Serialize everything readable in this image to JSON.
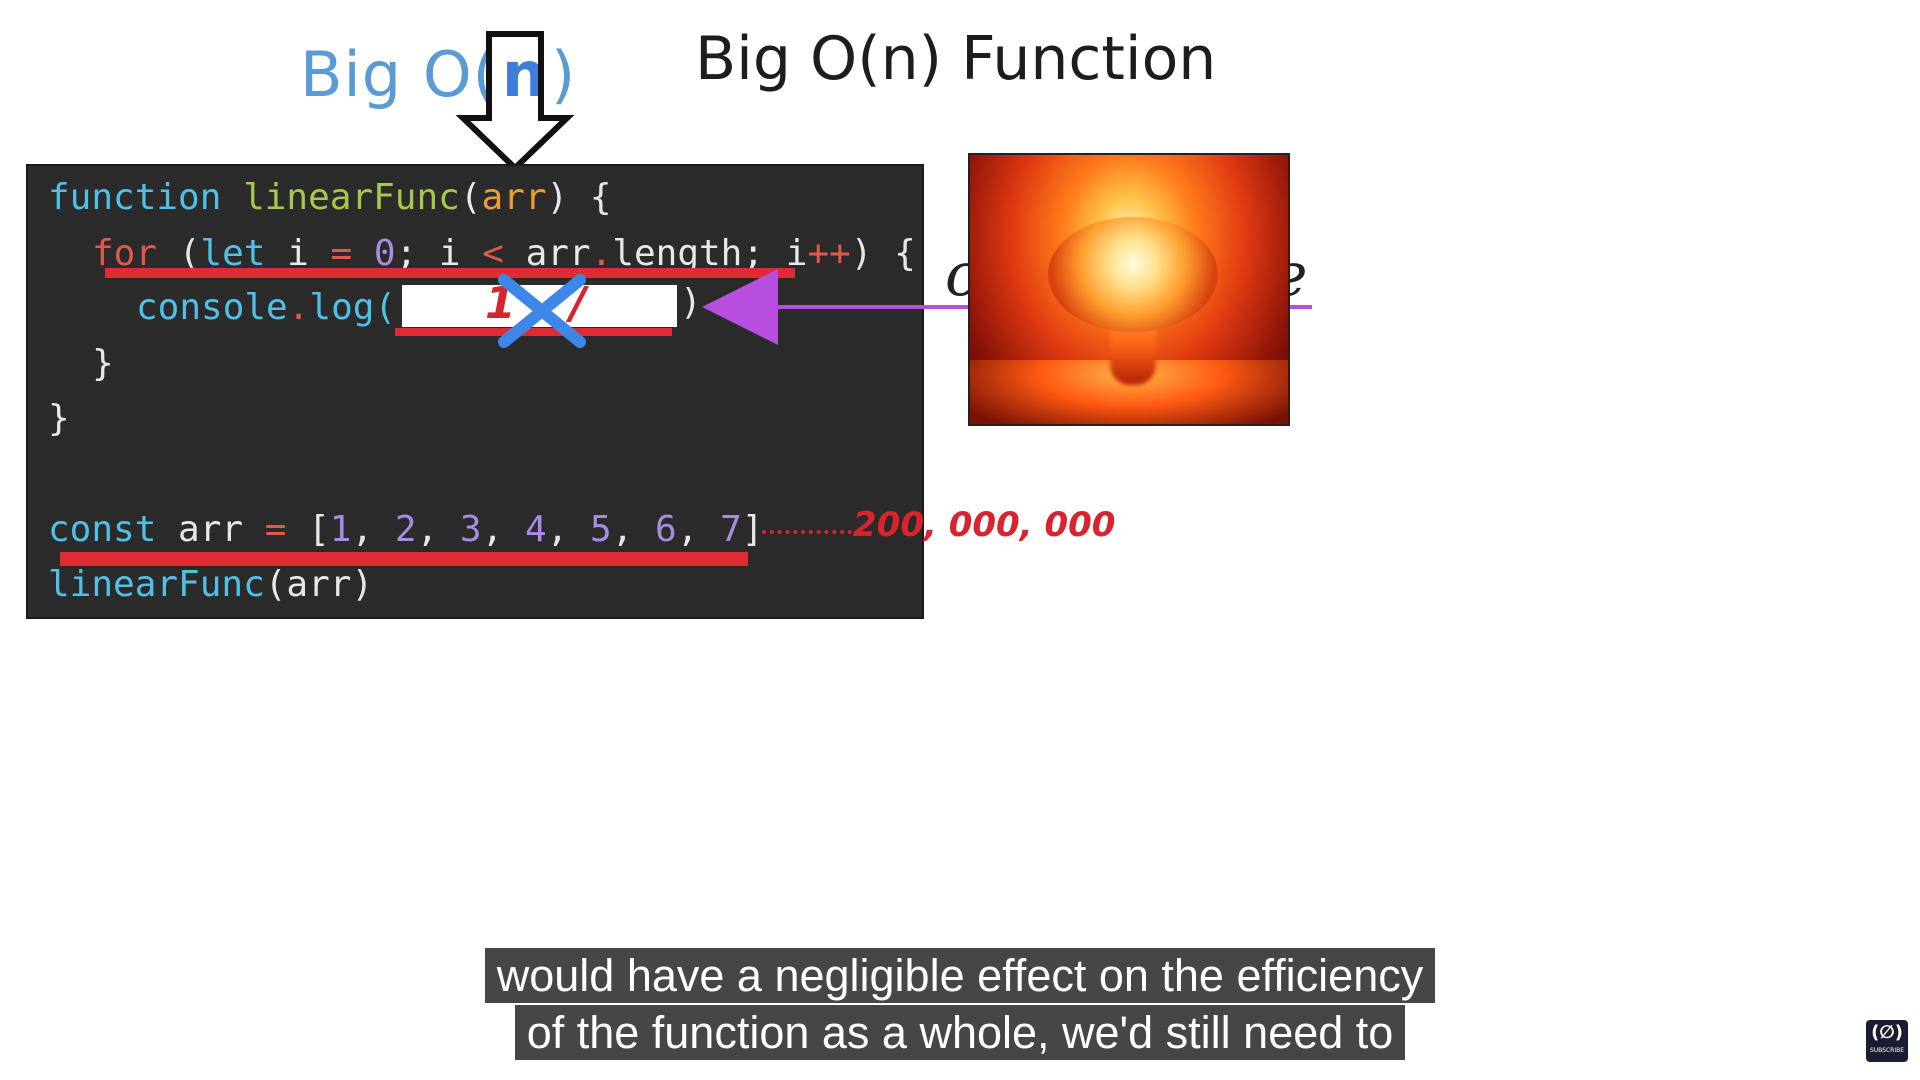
{
  "titles": {
    "bigo_prefix": "Big O(",
    "bigo_var": "n",
    "bigo_suffix": ")",
    "function_title": "Big O(n) Function"
  },
  "code": {
    "line1": {
      "kw": "function",
      "fn": "linearFunc",
      "open": "(",
      "param": "arr",
      "close": ") {"
    },
    "line2": {
      "kw": "for",
      "p1": " (",
      "kw2": "let",
      "p2": " i ",
      "eq": "=",
      "sp": " ",
      "zero": "0",
      "p3": "; i ",
      "lt": "<",
      "p4": " arr",
      "dot": ".",
      "p5": "length; i",
      "pp": "++",
      "p6": ") {"
    },
    "line3": {
      "obj": "console",
      "dot": ".",
      "method": "log("
    },
    "line4": "}",
    "line5": "}",
    "line6": {
      "kw": "const",
      "name": " arr ",
      "eq": "=",
      "open": " [",
      "n1": "1",
      "n2": "2",
      "n3": "3",
      "n4": "4",
      "n5": "5",
      "n6": "6",
      "n7": "7",
      "close": "]",
      "sep": ", "
    },
    "line7": {
      "fn": "linearFunc",
      "args": "(arr)"
    },
    "log_close": ")"
  },
  "annotations": {
    "red_one": "1",
    "red_slash": "/",
    "big_number": "200, 000, 000",
    "italic_left": "c",
    "italic_right": "e"
  },
  "captions": {
    "line1": "would have a negligible effect on the efficiency",
    "line2": "of the function as a whole, we'd still need to"
  },
  "logo": {
    "glyph": "(∅)",
    "label": "SUBSCRIBE"
  },
  "colors": {
    "code_background": "#2b2b2b",
    "red_annotation": "#d9232e",
    "purple_arrow": "#b84ee0",
    "blue_title": "#5b9bd5"
  },
  "icons": {
    "down_arrow": "down-arrow-icon",
    "left_arrow": "left-arrow-icon",
    "blue_x": "x-mark-icon"
  }
}
